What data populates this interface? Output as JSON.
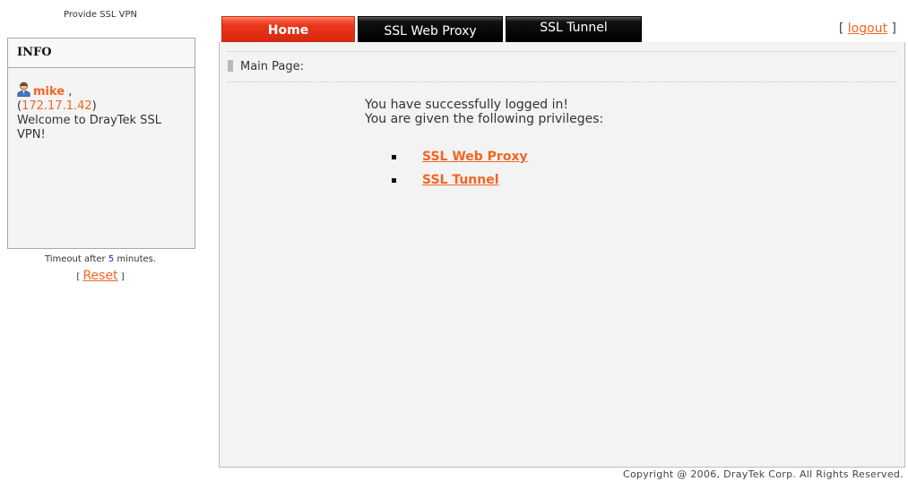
{
  "brand": {
    "tagline": "Provide SSL VPN"
  },
  "info": {
    "title": "INFO",
    "username": "mike",
    "comma": " ,",
    "ip_open": "(",
    "ip": "172.17.1.42",
    "ip_close": ")",
    "welcome": "Welcome to DrayTek SSL VPN!",
    "user_icon": "user-icon"
  },
  "timeout": {
    "prefix": "Timeout after ",
    "minutes": "5",
    "suffix": " minutes."
  },
  "reset": {
    "open": "[ ",
    "label": "Reset",
    "close": " ]"
  },
  "tabs": [
    {
      "label": "Home",
      "active": true
    },
    {
      "label": "SSL Web Proxy",
      "active": false
    },
    {
      "label": "SSL Tunnel",
      "active": false
    }
  ],
  "logout": {
    "open": "[ ",
    "label": "logout",
    "close": " ]"
  },
  "main": {
    "page_title": "Main Page:",
    "message_line1": "You have successfully logged in!",
    "message_line2": "You are given the following privileges:",
    "privileges": [
      "SSL Web Proxy",
      "SSL Tunnel"
    ]
  },
  "footer": {
    "copyright": "Copyright @ 2006, DrayTek Corp. All Rights Reserved."
  },
  "colors": {
    "accent": "#f26522",
    "tab_active": "#e8361b",
    "tab_inactive": "#000000",
    "panel_bg": "#f3f3f3"
  }
}
